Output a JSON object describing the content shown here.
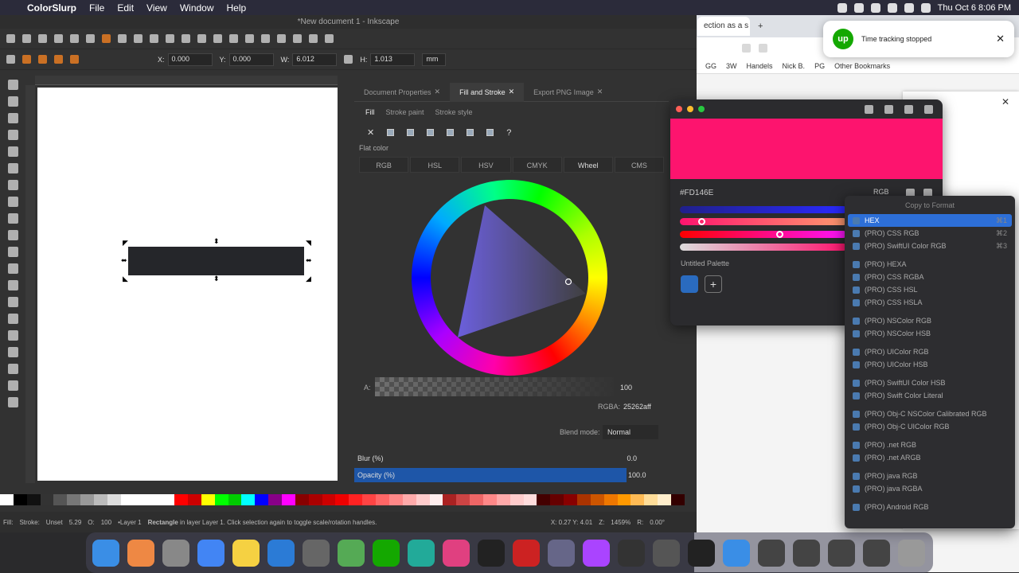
{
  "menubar": {
    "app": "ColorSlurp",
    "items": [
      "File",
      "Edit",
      "View",
      "Window",
      "Help"
    ],
    "datetime": "Thu Oct 6  8:06 PM"
  },
  "browser": {
    "tab_label": "ection as a s",
    "bookmarks": [
      "GG",
      "3W",
      "Handels",
      "Nick B.",
      "PG",
      "Other Bookmarks"
    ]
  },
  "notification": {
    "logo": "up",
    "text": "Time tracking stopped",
    "close": "✕"
  },
  "inkscape": {
    "title": "*New document 1 - Inkscape",
    "fields": {
      "x_label": "X:",
      "x": "0.000",
      "y_label": "Y:",
      "y": "0.000",
      "w_label": "W:",
      "w": "6.012",
      "h_label": "H:",
      "h": "1.013",
      "unit": "mm"
    },
    "dock_tabs": [
      "Document Properties",
      "Fill and Stroke",
      "Export PNG Image"
    ],
    "sub_tabs": [
      "Fill",
      "Stroke paint",
      "Stroke style"
    ],
    "flat_color": "Flat color",
    "color_modes": [
      "RGB",
      "HSL",
      "HSV",
      "CMYK",
      "Wheel",
      "CMS"
    ],
    "alpha_label": "A:",
    "alpha_value": "100",
    "rgba_label": "RGBA:",
    "rgba_value": "25262aff",
    "blend_label": "Blend mode:",
    "blend_value": "Normal",
    "blur_label": "Blur (%)",
    "blur_value": "0.0",
    "opacity_label": "Opacity (%)",
    "opacity_value": "100.0",
    "status": {
      "fill": "Fill:",
      "stroke": "Stroke:",
      "stroke_val": "Unset",
      "stroke_w": "5.29",
      "o": "O:",
      "o_val": "100",
      "layer": "•Layer 1",
      "msg_bold": "Rectangle",
      "msg_rest": " in layer Layer 1. Click selection again to toggle scale/rotation handles.",
      "xy": "X: 0.27  Y: 4.01",
      "z": "Z:",
      "zoom": "1459%",
      "r": "R:",
      "rot": "0.00°"
    }
  },
  "colorslurp": {
    "hex": "#FD146E",
    "format": "RGB",
    "palette": "Untitled Palette",
    "menu_title": "Copy to Format",
    "menu": [
      {
        "label": "HEX",
        "sc": "⌘1",
        "sel": true
      },
      {
        "label": "(PRO) CSS RGB",
        "sc": "⌘2"
      },
      {
        "label": "(PRO) SwiftUI Color RGB",
        "sc": "⌘3"
      },
      {
        "gap": true
      },
      {
        "label": "(PRO) HEXA"
      },
      {
        "label": "(PRO) CSS RGBA"
      },
      {
        "label": "(PRO) CSS HSL"
      },
      {
        "label": "(PRO) CSS HSLA"
      },
      {
        "gap": true
      },
      {
        "label": "(PRO) NSColor RGB"
      },
      {
        "label": "(PRO) NSColor HSB"
      },
      {
        "gap": true
      },
      {
        "label": "(PRO) UIColor RGB"
      },
      {
        "label": "(PRO) UIColor HSB"
      },
      {
        "gap": true
      },
      {
        "label": "(PRO) SwiftUI Color HSB"
      },
      {
        "label": "(PRO) Swift Color Literal"
      },
      {
        "gap": true
      },
      {
        "label": "(PRO) Obj-C NSColor Calibrated RGB"
      },
      {
        "label": "(PRO) Obj-C UIColor RGB"
      },
      {
        "gap": true
      },
      {
        "label": "(PRO) .net RGB"
      },
      {
        "label": "(PRO) .net ARGB"
      },
      {
        "gap": true
      },
      {
        "label": "(PRO) java RGB"
      },
      {
        "label": "(PRO) java RGBA"
      },
      {
        "gap": true
      },
      {
        "label": "(PRO) Android RGB"
      }
    ]
  },
  "dock": {
    "apps": [
      "Finder",
      "Launchpad",
      "Settings",
      "Chrome",
      "Notes",
      "VS Code",
      "Calculator",
      "Shortcuts",
      "Upwork",
      "Mail",
      "Slack",
      "GitHub",
      "FileZilla",
      "Preview",
      "Messenger",
      "Inkscape",
      "App",
      "Screen",
      "Folder",
      "Window",
      "Window",
      "Window",
      "Window",
      "Trash"
    ]
  }
}
